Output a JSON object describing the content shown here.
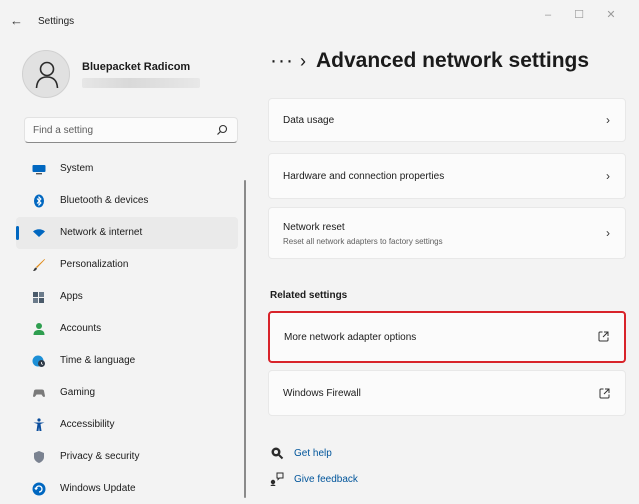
{
  "window": {
    "title": "Settings",
    "minimize": "–",
    "maximize": "☐",
    "close": "✕",
    "back": "←"
  },
  "profile": {
    "name": "Bluepacket Radicom"
  },
  "search": {
    "placeholder": "Find a setting"
  },
  "sidebar": {
    "items": [
      {
        "label": "System",
        "icon": "monitor-icon",
        "color": "#0067c0"
      },
      {
        "label": "Bluetooth & devices",
        "icon": "bluetooth-icon",
        "color": "#0067c0"
      },
      {
        "label": "Network & internet",
        "icon": "wifi-icon",
        "color": "#0067c0",
        "selected": true
      },
      {
        "label": "Personalization",
        "icon": "brush-icon",
        "color": "#e08a17"
      },
      {
        "label": "Apps",
        "icon": "apps-icon",
        "color": "#4a5a6a"
      },
      {
        "label": "Accounts",
        "icon": "person-icon",
        "color": "#2e9e4f"
      },
      {
        "label": "Time & language",
        "icon": "globe-clock-icon",
        "color": "#1c8fd6"
      },
      {
        "label": "Gaming",
        "icon": "gamepad-icon",
        "color": "#7a7a7a"
      },
      {
        "label": "Accessibility",
        "icon": "accessibility-icon",
        "color": "#0a4d9c"
      },
      {
        "label": "Privacy & security",
        "icon": "shield-icon",
        "color": "#7a8290"
      },
      {
        "label": "Windows Update",
        "icon": "update-icon",
        "color": "#0067c0"
      }
    ]
  },
  "header": {
    "ellipsis": "···",
    "separator": "›",
    "title": "Advanced network settings"
  },
  "cards": {
    "data_usage": {
      "label": "Data usage"
    },
    "hardware": {
      "label": "Hardware and connection properties"
    },
    "reset": {
      "label": "Network reset",
      "sub": "Reset all network adapters to factory settings"
    }
  },
  "related": {
    "heading": "Related settings",
    "adapter": {
      "label": "More network adapter options"
    },
    "firewall": {
      "label": "Windows Firewall"
    }
  },
  "help": {
    "get_help": "Get help",
    "feedback": "Give feedback"
  },
  "colors": {
    "accent": "#0067c0",
    "highlight": "#d8232a",
    "link": "#00559b"
  }
}
